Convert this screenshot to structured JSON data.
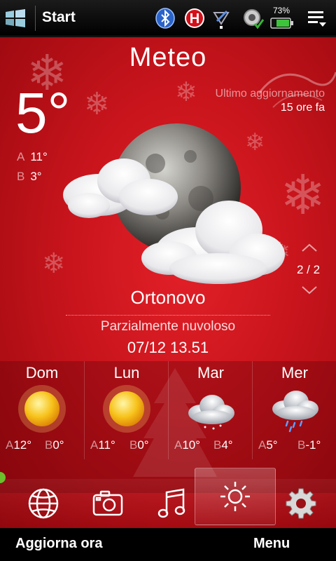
{
  "status_bar": {
    "start_label": "Start",
    "battery_percent": "73%",
    "icons": [
      "windows-start-icon",
      "bluetooth-icon",
      "hsdpa-icon",
      "signal-icon",
      "sync-icon",
      "battery-icon",
      "menu-icon"
    ]
  },
  "weather": {
    "title": "Meteo",
    "update_label": "Ultimo aggiornamento",
    "update_value": "15 ore fa",
    "current_temp": "5°",
    "high_label": "A",
    "high_value": "11°",
    "low_label": "B",
    "low_value": "3°",
    "page_indicator": "2 / 2",
    "city": "Ortonovo",
    "condition": "Parzialmente nuvoloso",
    "datetime": "07/12 13.51",
    "condition_icon": "moon-cloud-icon"
  },
  "forecast": [
    {
      "day": "Dom",
      "icon": "sun-icon",
      "high_label": "A",
      "high": "12°",
      "low_label": "B",
      "low": "0°"
    },
    {
      "day": "Lun",
      "icon": "sun-icon",
      "high_label": "A",
      "high": "11°",
      "low_label": "B",
      "low": "0°"
    },
    {
      "day": "Mar",
      "icon": "cloud-icon",
      "high_label": "A",
      "high": "10°",
      "low_label": "B",
      "low": "4°"
    },
    {
      "day": "Mer",
      "icon": "rain-cloud-icon",
      "high_label": "A",
      "high": "5°",
      "low_label": "B",
      "low": "-1°"
    }
  ],
  "launcher": {
    "items": [
      "globe-icon",
      "camera-icon",
      "music-icon",
      "weather-sun-icon",
      "settings-gear-icon"
    ],
    "selected": "weather-sun-icon"
  },
  "softkeys": {
    "left": "Aggiorna ora",
    "right": "Menu"
  },
  "colors": {
    "background_red": "#c8141c",
    "battery_green": "#3ec43a",
    "sun_yellow": "#f7c21a"
  }
}
